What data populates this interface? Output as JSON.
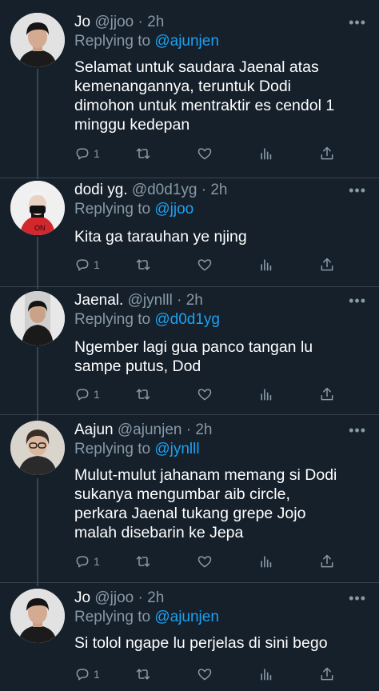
{
  "tweets": [
    {
      "name": "Jo",
      "handle": "@jjoo",
      "time": "2h",
      "replying_label": "Replying to",
      "replying_to": "@ajunjen",
      "text": "Selamat untuk saudara Jaenal atas\nkemenangannya, teruntuk Dodi\ndimohon untuk mentraktir es cendol 1\nminggu kedepan",
      "reply_count": "1"
    },
    {
      "name": "dodi yg.",
      "handle": "@d0d1yg",
      "time": "2h",
      "replying_label": "Replying to",
      "replying_to": "@jjoo",
      "text": "Kita ga tarauhan ye njing",
      "reply_count": "1"
    },
    {
      "name": "Jaenal.",
      "handle": "@jynlll",
      "time": "2h",
      "replying_label": "Replying to",
      "replying_to": "@d0d1yg",
      "text": "Ngember lagi gua panco tangan lu\nsampe putus, Dod",
      "reply_count": "1"
    },
    {
      "name": "Aajun",
      "handle": "@ajunjen",
      "time": "2h",
      "replying_label": "Replying to",
      "replying_to": "@jynlll",
      "text": "Mulut-mulut jahanam memang si Dodi\nsukanya mengumbar aib circle,\nperkara Jaenal tukang grepe Jojo\nmalah disebarin ke Jepa",
      "reply_count": "1"
    },
    {
      "name": "Jo",
      "handle": "@jjoo",
      "time": "2h",
      "replying_label": "Replying to",
      "replying_to": "@ajunjen",
      "text": "Si tolol ngape lu perjelas di sini bego",
      "reply_count": "1"
    }
  ],
  "icons": {
    "more": "more-horizontal-icon",
    "reply": "reply-bubble-icon",
    "retweet": "retweet-icon",
    "like": "heart-icon",
    "analytics": "analytics-bars-icon",
    "share": "share-upload-icon"
  },
  "colors": {
    "background": "#15202b",
    "secondary_text": "#8899a6",
    "link": "#1da1f2",
    "divider": "#38444d"
  }
}
